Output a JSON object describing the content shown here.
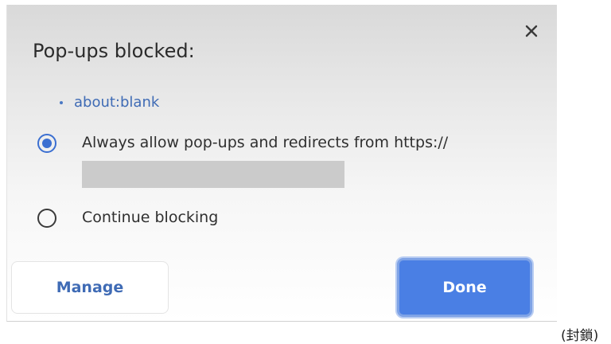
{
  "dialog": {
    "title": "Pop-ups blocked:",
    "close_icon": "close-icon",
    "blocked_popups": [
      "about:blank"
    ],
    "options": [
      {
        "label": "Always allow pop-ups and redirects from https://",
        "selected": true
      },
      {
        "label": "Continue blocking",
        "selected": false
      }
    ],
    "manage_label": "Manage",
    "done_label": "Done"
  },
  "footnote": "(封鎖)",
  "colors": {
    "accent": "#3b6fd1",
    "link": "#3f6bb5",
    "done_button": "#4a7fe4"
  }
}
